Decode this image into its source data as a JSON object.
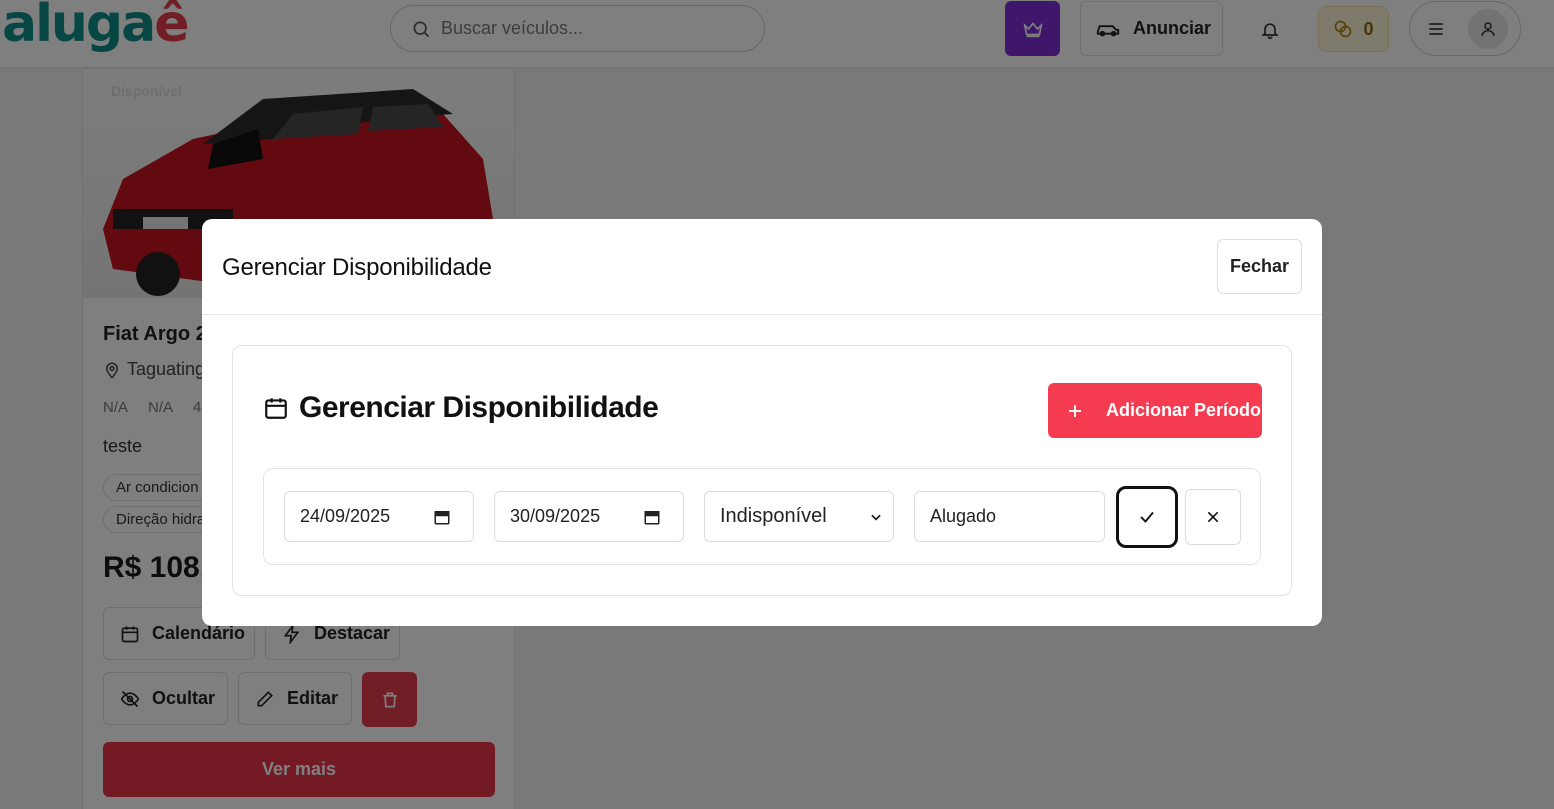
{
  "header": {
    "logo_part1": "aluga",
    "logo_part2": "ê",
    "search_placeholder": "Buscar veículos...",
    "anunciar_label": "Anunciar",
    "coins_count": "0",
    "premium_color": "#7c2fd6"
  },
  "card": {
    "status_badge": "Disponível",
    "title": "Fiat Argo 2",
    "location": "Taguating",
    "specs": [
      "N/A",
      "N/A",
      "4"
    ],
    "description": "teste",
    "tags": [
      "Ar condicion",
      "Direção hidra"
    ],
    "price": "R$ 108,",
    "buttons": {
      "calendar": "Calendário",
      "highlight": "Destacar",
      "hide": "Ocultar",
      "edit": "Editar"
    },
    "see_more": "Ver mais"
  },
  "modal": {
    "title": "Gerenciar Disponibilidade",
    "close_label": "Fechar",
    "panel_title": "Gerenciar Disponibilidade",
    "add_period_label": "Adicionar Período",
    "accent_color": "#f53b4f",
    "period": {
      "start_date": "24/09/2025",
      "end_date": "30/09/2025",
      "status": "Indisponível",
      "reason": "Alugado"
    }
  }
}
